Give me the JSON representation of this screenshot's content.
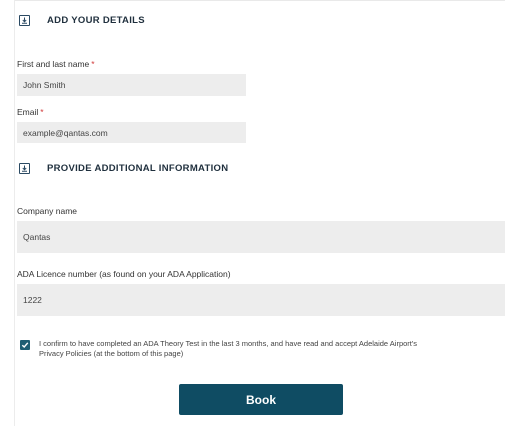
{
  "sections": {
    "details_title": "ADD YOUR DETAILS",
    "additional_title": "PROVIDE ADDITIONAL INFORMATION"
  },
  "fields": {
    "name": {
      "label": "First and last name",
      "required": "*",
      "value": "John Smith"
    },
    "email": {
      "label": "Email",
      "required": "*",
      "value": "example@qantas.com"
    },
    "company": {
      "label": "Company name",
      "value": "Qantas"
    },
    "licence": {
      "label": "ADA Licence number (as found on your ADA Application)",
      "value": "1222"
    }
  },
  "consent": {
    "checked": true,
    "line1": "I confirm to have completed an ADA Theory Test in the last 3 months, and have read and accept Adelaide Airport's",
    "line2": "Privacy Policies (at the bottom of this page)"
  },
  "actions": {
    "book_label": "Book"
  },
  "colors": {
    "accent": "#0f4c63",
    "required": "#d23b3b",
    "field_bg": "#ededed"
  }
}
